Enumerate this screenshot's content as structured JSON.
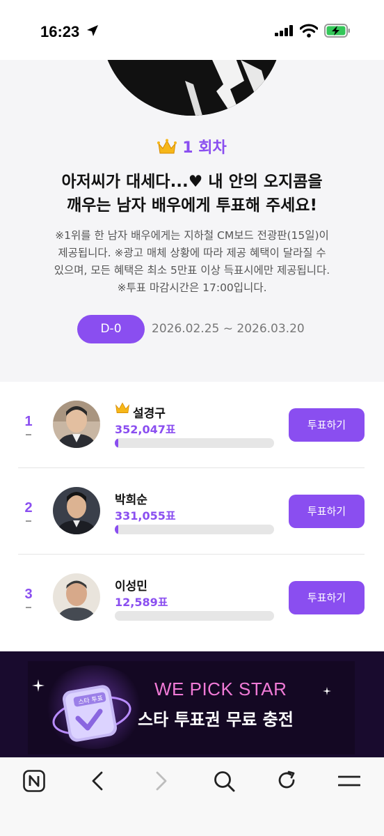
{
  "status_bar": {
    "time": "16:23"
  },
  "hero": {
    "round_label": "1 회차",
    "title_line1": "아저씨가 대세다...",
    "title_heart": "♥",
    "title_line1_end": " 내 안의 오지콤을",
    "title_line2": "깨우는 남자 배우에게 투표해 주세요!",
    "notice_line1": "※1위를 한 남자 배우에게는 지하철 CM보드 전광판(15일)이",
    "notice_line2": "제공됩니다. ※광고 매체 상황에 따라 제공 혜택이 달라질 수",
    "notice_line3": "있으며, 모든 혜택은 최소 5만표 이상 득표시에만 제공됩니다.",
    "notice_line4": "※투표 마감시간은 17:00입니다.",
    "dday": "D-0",
    "period": "2026.02.25 ~ 2026.03.20"
  },
  "candidates": [
    {
      "rank": "1",
      "name": "설경구",
      "votes": "352,047표",
      "bar_fraction": 0.02,
      "button": "투표하기",
      "crown": true
    },
    {
      "rank": "2",
      "name": "박희순",
      "votes": "331,055표",
      "bar_fraction": 0.02,
      "button": "투표하기",
      "crown": false
    },
    {
      "rank": "3",
      "name": "이성민",
      "votes": "12,589표",
      "bar_fraction": 0.0,
      "button": "투표하기",
      "crown": false
    }
  ],
  "banner": {
    "line1": "WE PICK STAR",
    "line2": "스타 투표권 무료 충전",
    "ticket_text": "스타 투표"
  },
  "toolbar": {
    "icons": [
      "naver-home-icon",
      "back-icon",
      "forward-icon",
      "search-icon",
      "refresh-icon",
      "menu-icon"
    ]
  },
  "colors": {
    "accent": "#8a4ef0",
    "banner_bg": "#190b2e",
    "banner_pink": "#f07ad6"
  }
}
